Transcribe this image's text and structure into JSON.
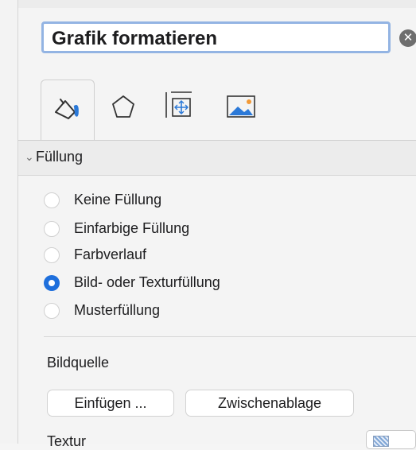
{
  "pane": {
    "title": "Grafik formatieren",
    "close_glyph": "✕"
  },
  "tabs": [
    {
      "name": "fill-line-tab",
      "icon": "paint-bucket-icon",
      "active": true
    },
    {
      "name": "effects-tab",
      "icon": "pentagon-icon",
      "active": false
    },
    {
      "name": "size-properties-tab",
      "icon": "size-position-icon",
      "active": false
    },
    {
      "name": "picture-tab",
      "icon": "picture-icon",
      "active": false
    }
  ],
  "fill_section": {
    "title": "Füllung",
    "options": [
      {
        "label": "Keine Füllung",
        "checked": false
      },
      {
        "label": "Einfarbige Füllung",
        "checked": false
      },
      {
        "label": "Farbverlauf",
        "checked": false
      },
      {
        "label": "Bild- oder Texturfüllung",
        "checked": true
      },
      {
        "label": "Musterfüllung",
        "checked": false
      }
    ],
    "picture_source": {
      "title": "Bildquelle",
      "insert_button": "Einfügen ...",
      "clipboard_button": "Zwischenablage"
    },
    "texture_label": "Textur"
  },
  "colors": {
    "accent": "#1e6fdc",
    "title_focus_border": "#93b4e3"
  }
}
